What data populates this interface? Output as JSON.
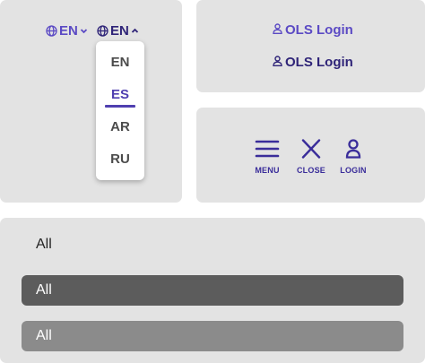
{
  "language": {
    "toggle_a_label": "EN",
    "toggle_b_label": "EN",
    "options": [
      "EN",
      "ES",
      "AR",
      "RU"
    ],
    "selected": "ES"
  },
  "login": {
    "link_1": "OLS Login",
    "link_2": "OLS Login"
  },
  "icon_buttons": {
    "menu": "MENU",
    "close": "CLOSE",
    "login": "LOGIN"
  },
  "filters": {
    "plain": "All",
    "dark": "All",
    "mid": "All"
  },
  "colors": {
    "accent": "#4f3fb0",
    "accent_dark": "#2f2478",
    "panel_bg": "#e3e3e3"
  }
}
